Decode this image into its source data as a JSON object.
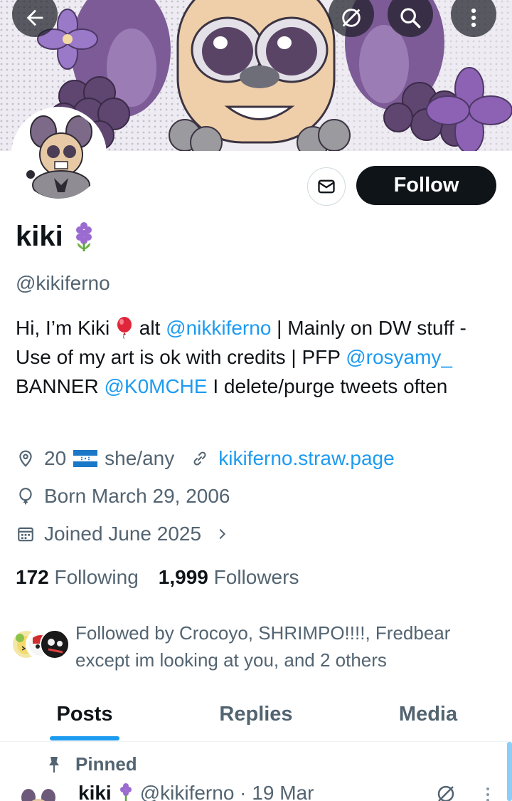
{
  "header": {
    "icons": [
      "arrow-left-icon",
      "grok-icon",
      "search-icon",
      "more-vertical-icon"
    ]
  },
  "profile": {
    "name": "kiki",
    "name_emoji": "hyacinth",
    "handle": "@kikiferno",
    "follow_label": "Follow",
    "bio": {
      "p1": "Hi, I’m Kiki ",
      "p2": " alt ",
      "link1": "@nikkiferno",
      "p3": " | Mainly on DW stuff - Use of my art is ok with credits | PFP ",
      "link2": "@rosyamy_",
      "p4": " BANNER ",
      "link3": "@K0MCHE",
      "p5": "  I delete/purge tweets often"
    },
    "location_age": "20",
    "pronouns": "she/any",
    "website": "kikiferno.straw.page",
    "born": "Born March 29, 2006",
    "joined": "Joined June 2025",
    "following_count": "172",
    "following_label": "Following",
    "followers_count": "1,999",
    "followers_label": "Followers",
    "followed_by": "Followed by Crocoyo, SHRIMPO!!!!, Fredbear except im looking at you, and 2 others"
  },
  "tabs": [
    {
      "label": "Posts",
      "active": true
    },
    {
      "label": "Replies",
      "active": false
    },
    {
      "label": "Media",
      "active": false
    }
  ],
  "pinned_post": {
    "pinned_label": "Pinned",
    "author": "kiki",
    "handle_date": "@kikiferno · 19 Mar"
  },
  "colors": {
    "accent": "#1d9bf0",
    "text_primary": "#0f1419",
    "text_secondary": "#536471",
    "banner_purple": "#7b5a96"
  }
}
